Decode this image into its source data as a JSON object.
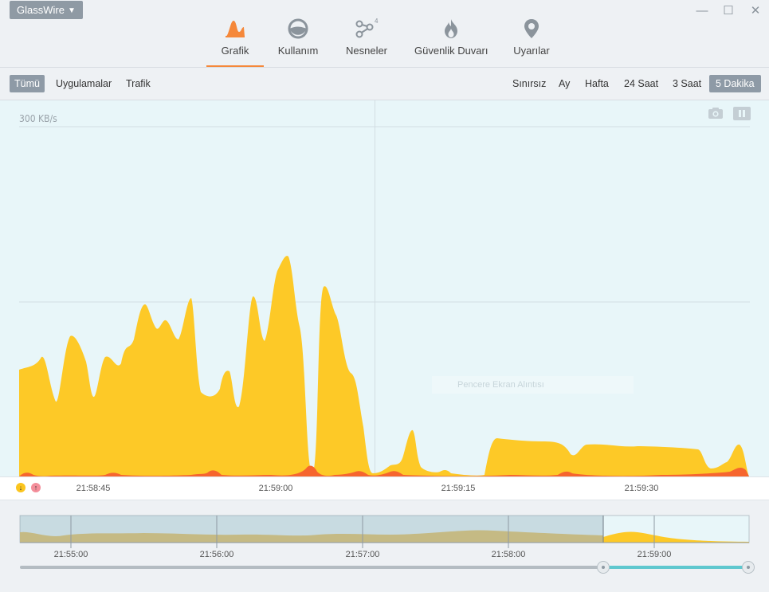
{
  "app": {
    "menu_label": "GlassWire"
  },
  "window_controls": {
    "minimize": "—",
    "maximize": "☐",
    "close": "✕"
  },
  "nav": {
    "tabs": [
      {
        "label": "Grafik",
        "icon": "graph-icon",
        "active": true
      },
      {
        "label": "Kullanım",
        "icon": "usage-icon",
        "active": false
      },
      {
        "label": "Nesneler",
        "icon": "things-icon",
        "badge": "4",
        "active": false
      },
      {
        "label": "Güvenlik Duvarı",
        "icon": "firewall-icon",
        "active": false
      },
      {
        "label": "Uyarılar",
        "icon": "alerts-icon",
        "active": false
      }
    ]
  },
  "filters": {
    "left": [
      "Tümü",
      "Uygulamalar",
      "Trafik"
    ],
    "left_selected": "Tümü",
    "right": [
      "Sınırsız",
      "Ay",
      "Hafta",
      "24 Saat",
      "3 Saat",
      "5 Dakika"
    ],
    "right_selected": "5 Dakika"
  },
  "graph": {
    "scale_label": "300 KB/s",
    "watermark": "Pencere Ekran Alıntısı",
    "x_ticks": [
      "21:58:45",
      "21:59:00",
      "21:59:15",
      "21:59:30"
    ],
    "legend": {
      "download_icon": "download-arrow-icon",
      "upload_icon": "upload-arrow-icon"
    },
    "colors": {
      "download": "#fbc51e",
      "upload": "#f7612a",
      "background": "#e8f6f9"
    }
  },
  "timeline": {
    "ticks": [
      "21:55:00",
      "21:56:00",
      "21:57:00",
      "21:58:00",
      "21:59:00"
    ],
    "slider_colors": {
      "track": "#b4bcc2",
      "selected": "#5fc8cf"
    }
  }
}
